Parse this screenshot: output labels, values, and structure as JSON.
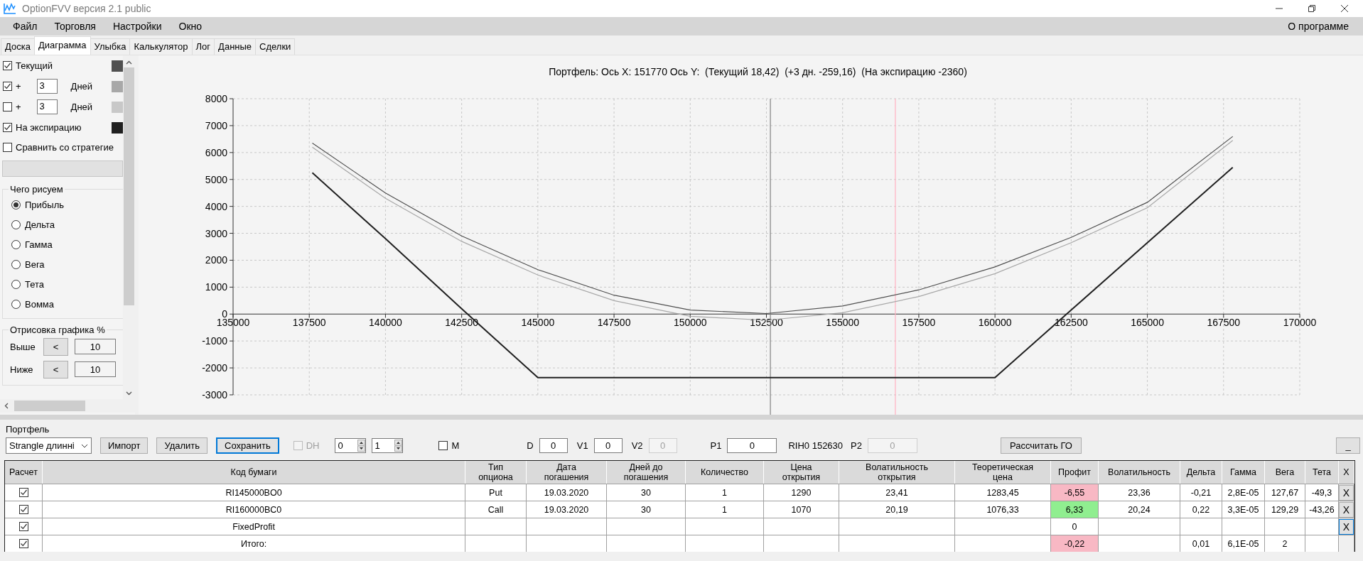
{
  "window": {
    "title": "OptionFVV версия 2.1 public"
  },
  "menu": {
    "items": [
      "Файл",
      "Торговля",
      "Настройки",
      "Окно"
    ],
    "right_item": "О программе"
  },
  "tabs": [
    {
      "label": "Доска",
      "selected": false
    },
    {
      "label": "Диаграмма",
      "selected": true
    },
    {
      "label": "Улыбка",
      "selected": false
    },
    {
      "label": "Калькулятор",
      "selected": false
    },
    {
      "label": "Лог",
      "selected": false
    },
    {
      "label": "Данные",
      "selected": false
    },
    {
      "label": "Сделки",
      "selected": false
    }
  ],
  "sidebar": {
    "curves": [
      {
        "kind": "label",
        "checked": true,
        "label": "Текущий",
        "color": "#505050"
      },
      {
        "kind": "days",
        "checked": true,
        "prefix": "+",
        "days": "3",
        "unit": "Дней",
        "color": "#a8a8a8"
      },
      {
        "kind": "days",
        "checked": false,
        "prefix": "+",
        "days": "3",
        "unit": "Дней",
        "color": "#c8c8c8"
      },
      {
        "kind": "label",
        "checked": true,
        "label": "На экспирацию",
        "color": "#202020"
      }
    ],
    "compare": {
      "checked": false,
      "label": "Сравнить со стратегие"
    },
    "plot_group": {
      "title": "Чего рисуем",
      "options": [
        {
          "label": "Прибыль",
          "selected": true
        },
        {
          "label": "Дельта",
          "selected": false
        },
        {
          "label": "Гамма",
          "selected": false
        },
        {
          "label": "Вега",
          "selected": false
        },
        {
          "label": "Тета",
          "selected": false
        },
        {
          "label": "Вомма",
          "selected": false
        }
      ]
    },
    "range_group": {
      "title": "Отрисовка графика %",
      "rows": [
        {
          "label": "Выше",
          "button": "<",
          "value": "10"
        },
        {
          "label": "Ниже",
          "button": "<",
          "value": "10"
        }
      ]
    }
  },
  "chart": {
    "title": "Портфель: Ось X: 151770 Ось Y:  (Текущий 18,42)  (+3 дн. -259,16)  (На экспирацию -2360)",
    "chart_data": {
      "type": "line",
      "x": [
        137600,
        140000,
        142500,
        145000,
        147500,
        150000,
        152500,
        155000,
        157500,
        160000,
        162500,
        165000,
        167800
      ],
      "series": [
        {
          "color": "#505050",
          "values": [
            6350,
            4500,
            2900,
            1650,
            700,
            150,
            20,
            300,
            900,
            1750,
            2850,
            4150,
            6600
          ]
        },
        {
          "color": "#a8a8a8",
          "values": [
            6200,
            4300,
            2700,
            1450,
            500,
            -80,
            -230,
            50,
            650,
            1500,
            2650,
            3950,
            6450
          ]
        },
        {
          "color": "#202020",
          "values": [
            5250,
            2800,
            200,
            -2360,
            -2360,
            -2360,
            -2360,
            -2360,
            -2360,
            -2360,
            150,
            2650,
            5450
          ]
        }
      ],
      "grid": true,
      "xlim": [
        135000,
        170000
      ],
      "ylim": [
        -3000,
        8000
      ],
      "xticks": [
        135000,
        137500,
        140000,
        142500,
        145000,
        147500,
        150000,
        152500,
        155000,
        157500,
        160000,
        162500,
        165000,
        167500,
        170000
      ],
      "yticks": [
        -3000,
        -2000,
        -1000,
        0,
        1000,
        2000,
        3000,
        4000,
        5000,
        6000,
        7000,
        8000
      ],
      "ref_lines": [
        {
          "axis": "x",
          "value": 152630,
          "color": "#808080"
        },
        {
          "axis": "x",
          "value": 156730,
          "color": "#ffb0c0"
        }
      ]
    }
  },
  "portfolio": {
    "title": "Портфель",
    "strategy": "Strangle длинні",
    "buttons": [
      {
        "label": "Импорт",
        "focused": false
      },
      {
        "label": "Удалить",
        "focused": false
      },
      {
        "label": "Сохранить",
        "focused": true
      }
    ],
    "dh": {
      "label": "DH",
      "checked": false,
      "disabled": true
    },
    "spinners": [
      "0",
      "1"
    ],
    "m": {
      "label": "M",
      "checked": false
    },
    "fields": [
      {
        "label": "D",
        "value": "0",
        "disabled": false
      },
      {
        "label": "V1",
        "value": "0",
        "disabled": false
      },
      {
        "label": "V2",
        "value": "0",
        "disabled": true
      },
      {
        "label": "P1",
        "value": "0",
        "disabled": false
      },
      {
        "label": "P2",
        "value": "0",
        "disabled": true
      }
    ],
    "price": "RIH0 152630",
    "calc_button": "Рассчитать ГО",
    "minimize_button": "_"
  },
  "table": {
    "columns": [
      "Расчет",
      "Код бумаги",
      "Тип\nопциона",
      "Дата\nпогашения",
      "Дней до\nпогашения",
      "Количество",
      "Цена\nоткрытия",
      "Волатильность\nоткрытия",
      "Теоретическая\nцена",
      "Профит",
      "Волатильность",
      "Дельта",
      "Гамма",
      "Вега",
      "Тета",
      "X"
    ],
    "rows": [
      {
        "cells": [
          {
            "kind": "checkbox",
            "checked": true
          },
          "RI145000BO0",
          "Put",
          "19.03.2020",
          "30",
          "1",
          "1290",
          "23,41",
          "1283,45",
          {
            "kind": "profit",
            "text": "-6,55",
            "color": "#f8b8c4"
          },
          "23,36",
          "-0,21",
          "2,8E-05",
          "127,67",
          "-49,3",
          {
            "kind": "button",
            "text": "X",
            "focused": false
          }
        ]
      },
      {
        "cells": [
          {
            "kind": "checkbox",
            "checked": true
          },
          "RI160000BC0",
          "Call",
          "19.03.2020",
          "30",
          "1",
          "1070",
          "20,19",
          "1076,33",
          {
            "kind": "profit",
            "text": "6,33",
            "color": "#90ee90"
          },
          "20,24",
          "0,22",
          "3,3E-05",
          "129,29",
          "-43,26",
          {
            "kind": "button",
            "text": "X",
            "focused": false
          }
        ]
      },
      {
        "cells": [
          {
            "kind": "checkbox",
            "checked": true
          },
          "FixedProfit",
          "",
          "",
          "",
          "",
          "",
          "",
          "",
          {
            "kind": "profit",
            "text": "0",
            "color": "#ffffff"
          },
          "",
          "",
          "",
          "",
          "",
          {
            "kind": "button",
            "text": "X",
            "focused": true
          }
        ]
      },
      {
        "cells": [
          {
            "kind": "checkbox",
            "checked": true
          },
          "Итого:",
          "",
          "",
          "",
          "",
          "",
          "",
          "",
          {
            "kind": "profit",
            "text": "-0,22",
            "color": "#f8b8c4"
          },
          "",
          "0,01",
          "6,1E-05",
          "2",
          "",
          ""
        ]
      }
    ]
  }
}
